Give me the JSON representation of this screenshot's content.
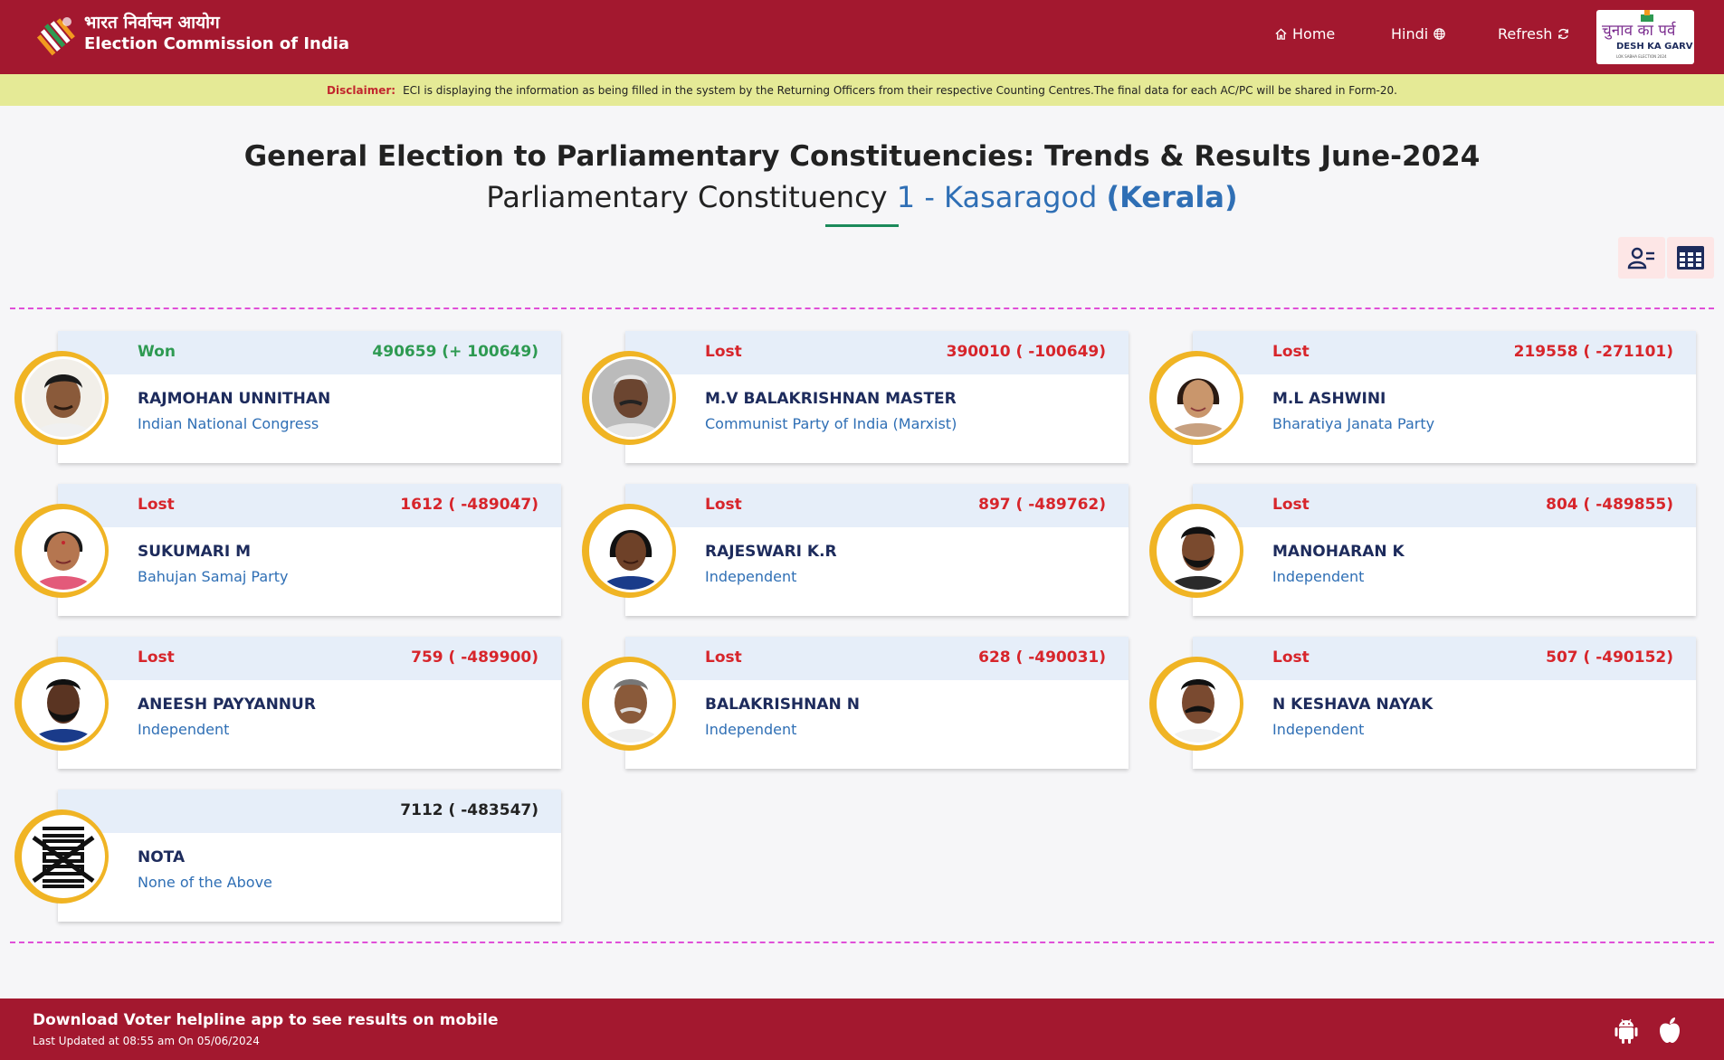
{
  "header": {
    "brand_hi": "भारत निर्वाचन आयोग",
    "brand_en": "Election Commission of India",
    "nav_home": "Home",
    "nav_hindi": "Hindi",
    "nav_refresh": "Refresh",
    "badge_hi": "चुनाव का पर्व",
    "badge_en": "DESH KA GARV",
    "badge_small": "LOK SABHA ELECTION 2024"
  },
  "disclaimer": {
    "label": "Disclaimer:",
    "text": "ECI is displaying the information as being filled in the system by the Returning Officers from their respective Counting Centres.The final data for each AC/PC will be shared in Form-20."
  },
  "page": {
    "title": "General Election to Parliamentary Constituencies: Trends & Results June-2024",
    "constituency_label": "Parliamentary Constituency",
    "constituency_name": "1 - Kasaragod",
    "state": "(Kerala)"
  },
  "candidates": [
    {
      "status": "Won",
      "votes": "490659 (+ 100649)",
      "name": "RAJMOHAN UNNITHAN",
      "party": "Indian National Congress"
    },
    {
      "status": "Lost",
      "votes": "390010 ( -100649)",
      "name": "M.V BALAKRISHNAN MASTER",
      "party": "Communist Party of India (Marxist)"
    },
    {
      "status": "Lost",
      "votes": "219558 ( -271101)",
      "name": "M.L ASHWINI",
      "party": "Bharatiya Janata Party"
    },
    {
      "status": "Lost",
      "votes": "1612 ( -489047)",
      "name": "SUKUMARI M",
      "party": "Bahujan Samaj Party"
    },
    {
      "status": "Lost",
      "votes": "897 ( -489762)",
      "name": "RAJESWARI K.R",
      "party": "Independent"
    },
    {
      "status": "Lost",
      "votes": "804 ( -489855)",
      "name": "MANOHARAN K",
      "party": "Independent"
    },
    {
      "status": "Lost",
      "votes": "759 ( -489900)",
      "name": "ANEESH PAYYANNUR",
      "party": "Independent"
    },
    {
      "status": "Lost",
      "votes": "628 ( -490031)",
      "name": "BALAKRISHNAN N",
      "party": "Independent"
    },
    {
      "status": "Lost",
      "votes": "507 ( -490152)",
      "name": "N KESHAVA NAYAK",
      "party": "Independent"
    },
    {
      "status": "",
      "votes": "7112 ( -483547)",
      "name": "NOTA",
      "party": "None of the Above"
    }
  ],
  "footer": {
    "download_text": "Download Voter helpline app to see results on mobile",
    "last_updated": "Last Updated at 08:55 am On 05/06/2024"
  },
  "colors": {
    "primary": "#a3182f",
    "won": "#2e9a52",
    "lost": "#d7252b",
    "party_blue": "#2f6fb5",
    "disclaimer_bg": "#e5ea96"
  }
}
